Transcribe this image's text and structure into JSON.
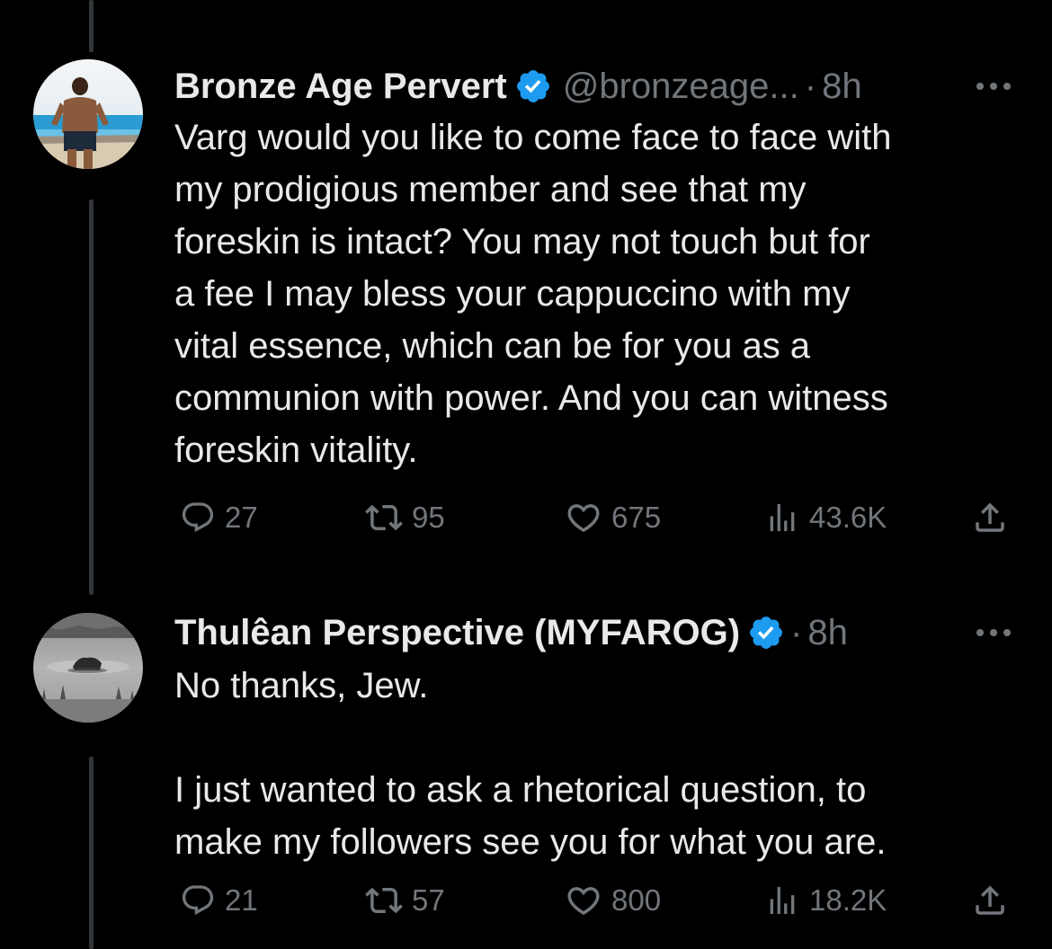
{
  "tweets": [
    {
      "display_name": "Bronze Age Pervert",
      "handle": "@bronzeage...",
      "separator": "·",
      "time": "8h",
      "text": "Varg would you like to come face to face with\nmy prodigious member and see that my\nforeskin is intact? You may not touch but for\na fee I may bless your cappuccino with my\nvital essence, which can be for you as a\ncommunion with power. And you can witness\nforeskin vitality.",
      "replies": "27",
      "retweets": "95",
      "likes": "675",
      "views": "43.6K"
    },
    {
      "display_name": "Thulêan Perspective (MYFAROG)",
      "handle": "",
      "separator": "·",
      "time": "8h",
      "text": "No thanks, Jew.\n\nI just wanted to ask a rhetorical question, to\nmake my followers see you for what you are.",
      "replies": "21",
      "retweets": "57",
      "likes": "800",
      "views": "18.2K"
    }
  ],
  "colors": {
    "background": "#000000",
    "text_primary": "#e7e9ea",
    "text_secondary": "#71767b",
    "verified_badge": "#1d9bf0",
    "thread_line": "#333639"
  },
  "icons": {
    "verified": "verified-badge-icon",
    "more": "more-options-icon",
    "reply": "reply-icon",
    "retweet": "retweet-icon",
    "like": "like-icon",
    "views": "views-icon",
    "share": "share-icon"
  }
}
